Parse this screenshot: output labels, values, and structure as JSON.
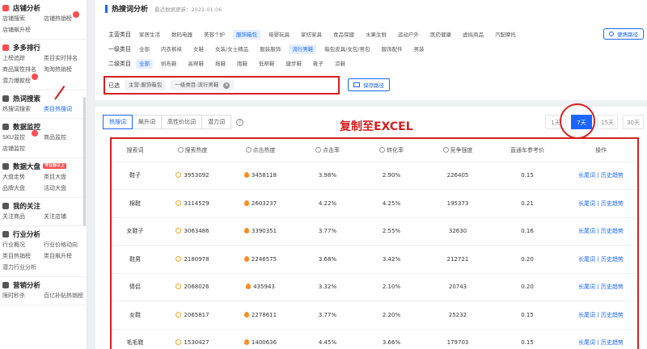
{
  "sidebar": {
    "sections": [
      {
        "title": "店铺分析",
        "icon": "store-icon",
        "color": "#ff4d4f",
        "items": [
          {
            "label": "店铺搜索"
          },
          {
            "label": "店铺热销榜",
            "dot": true
          },
          {
            "label": "店铺飙升榜"
          }
        ]
      },
      {
        "title": "多多排行",
        "icon": "rank-icon",
        "color": "#ff4d4f",
        "items": [
          {
            "label": "上榜追踪"
          },
          {
            "label": "类目实时排名"
          },
          {
            "label": "商品属性排名"
          },
          {
            "label": "淘淘热销榜"
          },
          {
            "label": "潜力爆款榜",
            "dot": true
          }
        ]
      },
      {
        "title": "热词搜索",
        "icon": "hotword-icon",
        "color": "#555",
        "items": [
          {
            "label": "热搜词搜索"
          },
          {
            "label": "类目热搜词",
            "active": true
          }
        ]
      },
      {
        "title": "数据监控",
        "icon": "monitor-icon",
        "color": "#555",
        "items": [
          {
            "label": "SKU监控",
            "dot": true
          },
          {
            "label": "商品监控"
          },
          {
            "label": "店铺监控"
          }
        ]
      },
      {
        "title": "数据大盘",
        "icon": "dashboard-icon",
        "color": "#555",
        "tag": "专业版以上",
        "items": [
          {
            "label": "大盘走势"
          },
          {
            "label": "类目大盘"
          },
          {
            "label": "品牌大盘"
          },
          {
            "label": "活动大盘"
          }
        ]
      },
      {
        "title": "我的关注",
        "icon": "follow-icon",
        "color": "#555",
        "items": [
          {
            "label": "关注商品"
          },
          {
            "label": "关注店铺"
          }
        ]
      },
      {
        "title": "行业分析",
        "icon": "industry-icon",
        "color": "#555",
        "items": [
          {
            "label": "行业概况"
          },
          {
            "label": "行业价格动向"
          },
          {
            "label": "类目热销榜"
          },
          {
            "label": "类目飙升榜"
          },
          {
            "label": "潜力行业分析"
          }
        ]
      },
      {
        "title": "营销分析",
        "icon": "marketing-icon",
        "color": "#555",
        "items": [
          {
            "label": "限时秒杀"
          },
          {
            "label": "百亿补贴热销榜"
          }
        ]
      }
    ]
  },
  "header": {
    "title": "热搜词分析",
    "update": "最近数据更新：2022-01-06",
    "fav_label": "便携路径"
  },
  "filters": {
    "main_label": "主营类目",
    "main": [
      "家居生活",
      "数码电器",
      "美容个护",
      "服饰箱包",
      "母婴玩具",
      "家纺家具",
      "食品保健",
      "水果生鲜",
      "运动户外",
      "医药健康",
      "虚拟商品",
      "汽配摩托"
    ],
    "main_sel": 3,
    "l1_label": "一级类目",
    "l1": [
      "全部",
      "内衣裤袜",
      "女鞋",
      "女装/女士精品",
      "服装服饰",
      "流行男鞋",
      "箱包皮具/女包/男包",
      "服饰配件",
      "男装"
    ],
    "l1_sel": 5,
    "l2_label": "二级类目",
    "l2": [
      "全部",
      "帆布鞋",
      "低帮鞋",
      "拖鞋",
      "雨鞋",
      "低帮鞋",
      "靴子",
      "凉鞋"
    ],
    "l2_override": [
      "全部",
      "帆布鞋",
      "高帮鞋",
      "拖鞋",
      "雨鞋",
      "低帮鞋",
      "健步鞋",
      "靴子",
      "凉鞋"
    ],
    "l2_sel": 0,
    "selected_label": "已选",
    "chips": [
      "主营:服饰箱包",
      "一级类目:流行男鞋"
    ],
    "save_label": "保存路径"
  },
  "tabs": [
    "热搜词",
    "飙升词",
    "高性价比词",
    "潜力词"
  ],
  "active_tab": 0,
  "annotation": "复制至EXCEL",
  "days": [
    "1天",
    "7天",
    "15天",
    "30天"
  ],
  "active_day": 1,
  "table": {
    "headers": [
      "搜索词",
      "搜索热度",
      "点击热度",
      "点击率",
      "转化率",
      "竞争强度",
      "直通车参考价",
      "操作"
    ],
    "rows": [
      [
        "鞋子",
        "3953092",
        "3458118",
        "3.98%",
        "2.90%",
        "226405",
        "0.15"
      ],
      [
        "棉鞋",
        "3114529",
        "2603237",
        "4.22%",
        "4.25%",
        "195373",
        "0.21"
      ],
      [
        "女鞋子",
        "3063486",
        "3390351",
        "3.77%",
        "2.55%",
        "32630",
        "0.16"
      ],
      [
        "鞋男",
        "2180978",
        "2246575",
        "3.68%",
        "3.42%",
        "212721",
        "0.20"
      ],
      [
        "情侣",
        "2068026",
        "435943",
        "3.32%",
        "2.10%",
        "20743",
        "0.20"
      ],
      [
        "女鞋",
        "2065817",
        "2278611",
        "3.77%",
        "2.20%",
        "25232",
        "0.15"
      ],
      [
        "毛毛鞋",
        "1530427",
        "1400636",
        "4.45%",
        "3.66%",
        "179703",
        "0.15"
      ]
    ],
    "action_label": "长尾词丨历史趋势"
  },
  "colors": {
    "accent": "#1a66ff",
    "annotation": "#d62020"
  }
}
